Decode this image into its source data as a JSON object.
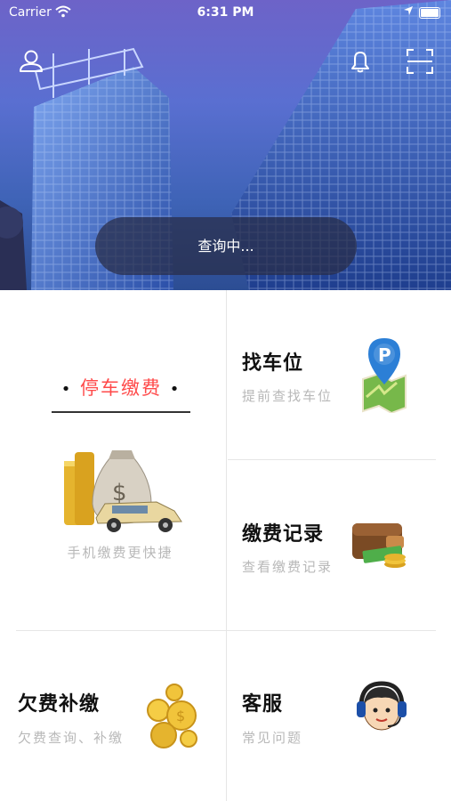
{
  "status_bar": {
    "carrier": "Carrier",
    "time": "6:31 PM",
    "icons": [
      "wifi-icon",
      "location-arrow-icon",
      "battery-icon"
    ]
  },
  "header": {
    "profile_icon": "user-icon",
    "notification_icon": "bell-icon",
    "scan_icon": "scan-icon",
    "query_status": "查询中..."
  },
  "menu": {
    "parking_payment": {
      "title": "停车缴费",
      "subtitle": "手机缴费更快捷",
      "icon": "money-bag-car-icon",
      "accent": "#ff4a4a"
    },
    "find_parking": {
      "title": "找车位",
      "subtitle": "提前查找车位",
      "icon": "parking-map-pin-icon"
    },
    "payment_records": {
      "title": "缴费记录",
      "subtitle": "查看缴费记录",
      "icon": "wallet-icon"
    },
    "arrears": {
      "title": "欠费补缴",
      "subtitle": "欠费查询、补缴",
      "icon": "gold-coins-icon"
    },
    "customer_service": {
      "title": "客服",
      "subtitle": "常见问题",
      "icon": "headset-agent-icon"
    }
  }
}
